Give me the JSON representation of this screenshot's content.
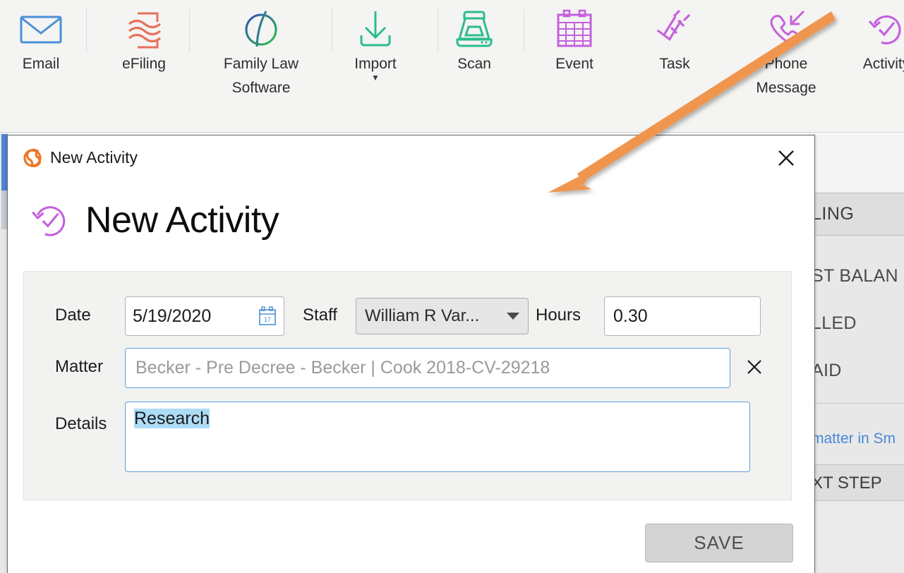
{
  "toolbar": {
    "items": [
      {
        "label": "Email",
        "icon": "envelope-icon",
        "color": "#4a90d9",
        "caret": ""
      },
      {
        "label": "eFiling",
        "icon": "efiling-icon",
        "color": "#e8705a",
        "caret": ""
      },
      {
        "label": "Family Law Software",
        "icon": "family-law-software-icon",
        "color": "#2a6fba",
        "caret": ""
      },
      {
        "label": "Import",
        "icon": "download-icon",
        "color": "#2bbd8c",
        "caret": "▼"
      },
      {
        "label": "Scan",
        "icon": "scanner-icon",
        "color": "#2bbd8c",
        "caret": ""
      },
      {
        "label": "Event",
        "icon": "calendar-icon",
        "color": "#c martial",
        "caret": ""
      },
      {
        "label": "Task",
        "icon": "checklist-icon",
        "color": "#c561dd",
        "caret": ""
      },
      {
        "label": "Phone Message",
        "icon": "incoming-call-icon",
        "color": "#c561dd",
        "caret": ""
      },
      {
        "label": "Activity",
        "icon": "activity-circular-check-icon",
        "color": "#c561dd",
        "caret": ""
      }
    ]
  },
  "dialog": {
    "titlebar_text": "New Activity",
    "logo_icon": "smokeball-logo-icon",
    "close_icon": "close-icon",
    "heading_icon": "activity-circular-check-icon",
    "heading_text": "New Activity",
    "form": {
      "date": {
        "label": "Date",
        "value": "5/19/2020",
        "calendar_icon": "calendar-picker-icon",
        "calendar_day": "17"
      },
      "staff": {
        "label": "Staff",
        "value": "William R Var...",
        "caret_icon": "chevron-down-icon"
      },
      "hours": {
        "label": "Hours",
        "value": "0.30"
      },
      "matter": {
        "label": "Matter",
        "placeholder": "Becker - Pre Decree - Becker | Cook 2018-CV-29218",
        "value": "",
        "clear_icon": "clear-x-icon"
      },
      "details": {
        "label": "Details",
        "value": "Research",
        "selected": true
      }
    },
    "save_label": "SAVE"
  },
  "background": {
    "header_text": "LING",
    "rows": [
      "ST BALAN",
      "LLED",
      "AID"
    ],
    "link_text": "matter in Sm",
    "next_step_text": "XT STEP"
  },
  "annotation": {
    "arrow_color": "#f0954d",
    "type": "arrow-annotation"
  },
  "colors": {
    "accent_blue": "#4a86d8",
    "purple": "#c561dd",
    "green": "#2bbd8c",
    "orange": "#e8772e",
    "selection_blue": "#addcf5"
  }
}
